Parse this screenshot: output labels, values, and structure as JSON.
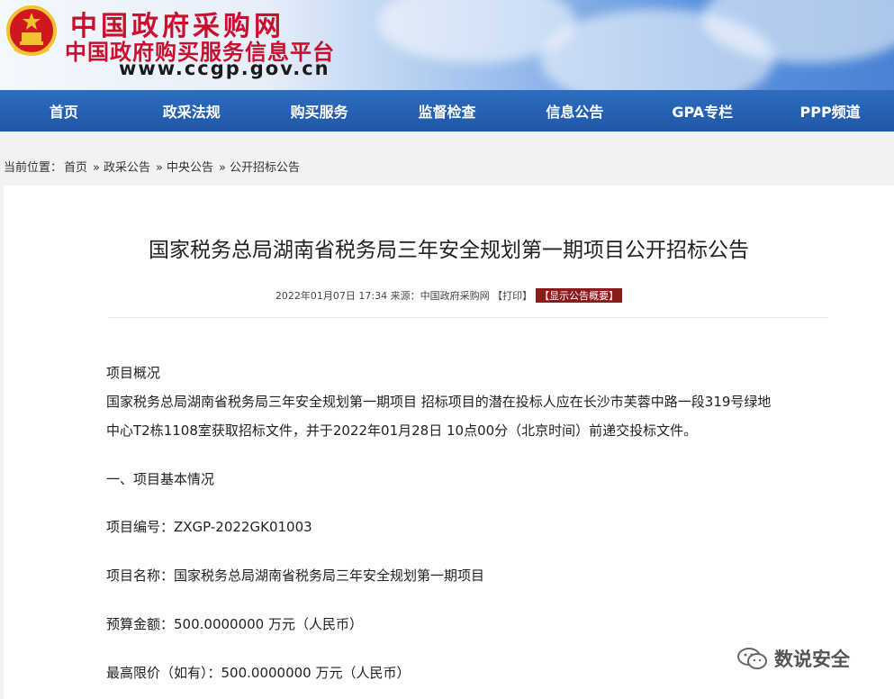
{
  "header": {
    "title": "中国政府采购网",
    "subtitle": "中国政府购买服务信息平台",
    "url": "www.ccgp.gov.cn"
  },
  "nav": {
    "items": [
      "首页",
      "政采法规",
      "购买服务",
      "监督检查",
      "信息公告",
      "GPA专栏",
      "PPP频道"
    ]
  },
  "breadcrumb": {
    "prefix": "当前位置：",
    "items": [
      "首页",
      "政采公告",
      "中央公告",
      "公开招标公告"
    ],
    "separator": "»"
  },
  "article": {
    "title": "国家税务总局湖南省税务局三年安全规划第一期项目公开招标公告",
    "datetime": "2022年01月07日 17:34",
    "source": "来源：中国政府采购网",
    "print_label": "【打印】",
    "summary_label": "【显示公告概要】",
    "section_overview": "项目概况",
    "overview_line1": "国家税务总局湖南省税务局三年安全规划第一期项目 招标项目的潜在投标人应在长沙市芙蓉中路一段319号绿地",
    "overview_line2": "中心T2栋1108室获取招标文件，并于2022年01月28日 10点00分（北京时间）前递交投标文件。",
    "section_basic": "一、项目基本情况",
    "project_number": "项目编号：ZXGP-2022GK01003",
    "project_name": "项目名称：国家税务总局湖南省税务局三年安全规划第一期项目",
    "budget": "预算金额：500.0000000 万元（人民币）",
    "max_price": "最高限价（如有）：500.0000000 万元（人民币）"
  },
  "watermark": {
    "text": "数说安全",
    "icon": "wechat-icon"
  },
  "colors": {
    "nav_bg": "#1f57a6",
    "logo_red": "#c8102e",
    "summary_bg": "#8b1a1a"
  }
}
